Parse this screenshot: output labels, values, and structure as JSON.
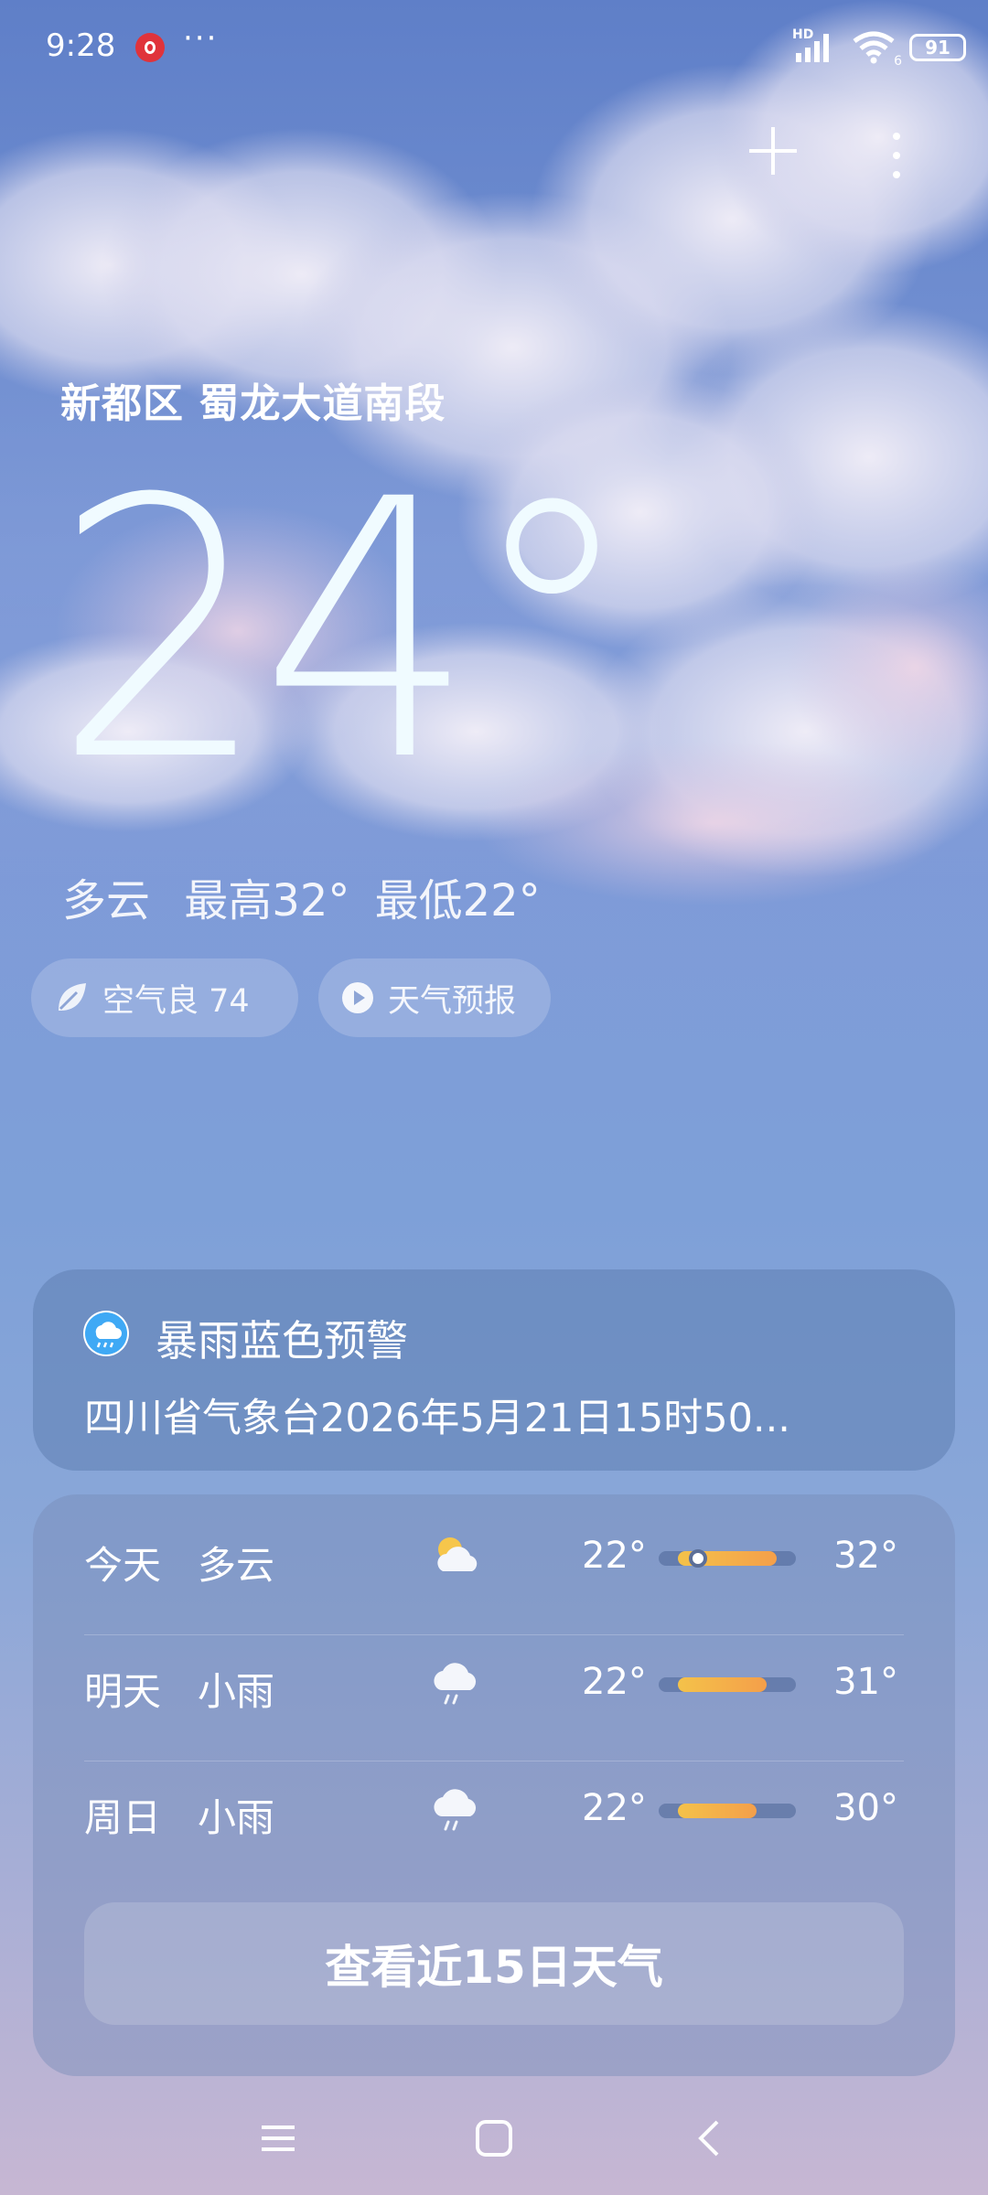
{
  "status_bar": {
    "time": "9:28",
    "more": "···",
    "network": "HD",
    "wifi_badge": "6",
    "battery": "91"
  },
  "location": "新都区 蜀龙大道南段",
  "current": {
    "temperature": "24°",
    "condition": "多云",
    "high": "最高32°",
    "low": "最低22°"
  },
  "chips": {
    "air": "空气良 74",
    "forecast_video": "天气预报"
  },
  "alert": {
    "title": "暴雨蓝色预警",
    "body": "四川省气象台2026年5月21日15时50..."
  },
  "forecast": [
    {
      "day": "今天",
      "condition": "多云",
      "icon": "partly-cloudy-icon",
      "low": "22°",
      "high": "32°",
      "low_value": 22,
      "high_value": 32,
      "current_value": 24
    },
    {
      "day": "明天",
      "condition": "小雨",
      "icon": "light-rain-icon",
      "low": "22°",
      "high": "31°",
      "low_value": 22,
      "high_value": 31
    },
    {
      "day": "周日",
      "condition": "小雨",
      "icon": "light-rain-icon",
      "low": "22°",
      "high": "30°",
      "low_value": 22,
      "high_value": 30
    }
  ],
  "forecast_range": {
    "min": 20,
    "max": 34
  },
  "cta": "查看近15日天气",
  "colors": {
    "bar_warm_start": "#f4c24a",
    "bar_warm_end": "#f49f4a",
    "alert_icon_blue": "#3fa9f5"
  }
}
